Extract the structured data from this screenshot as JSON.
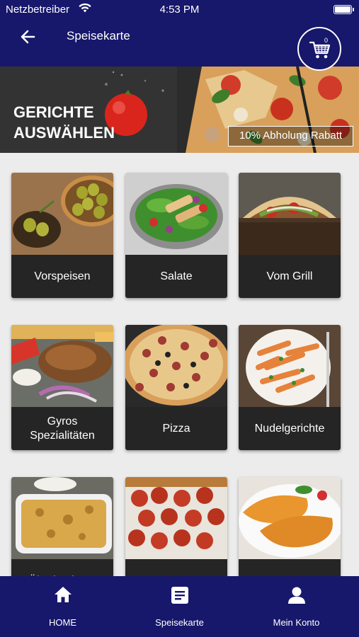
{
  "status_bar": {
    "carrier": "Netzbetreiber",
    "time": "4:53 PM"
  },
  "header": {
    "title": "Speisekarte",
    "cart_count": "0"
  },
  "banner": {
    "title_line1": "GERICHTE",
    "title_line2": "AUSWÄHLEN",
    "promo": "10% Abholung Rabatt"
  },
  "categories": [
    {
      "label": "Vorspeisen"
    },
    {
      "label": "Salate"
    },
    {
      "label": "Vom Grill"
    },
    {
      "label": "Gyros Spezialitäten"
    },
    {
      "label": "Pizza"
    },
    {
      "label": "Nudelgerichte"
    },
    {
      "label": "Überbackene"
    }
  ],
  "bottom_nav": [
    {
      "label": "HOME",
      "icon": "home-icon"
    },
    {
      "label": "Speisekarte",
      "icon": "menu-icon"
    },
    {
      "label": "Mein Konto",
      "icon": "account-icon"
    }
  ],
  "colors": {
    "primary": "#17176b",
    "card_label_bg": "#252525",
    "page_bg": "#ececec"
  }
}
